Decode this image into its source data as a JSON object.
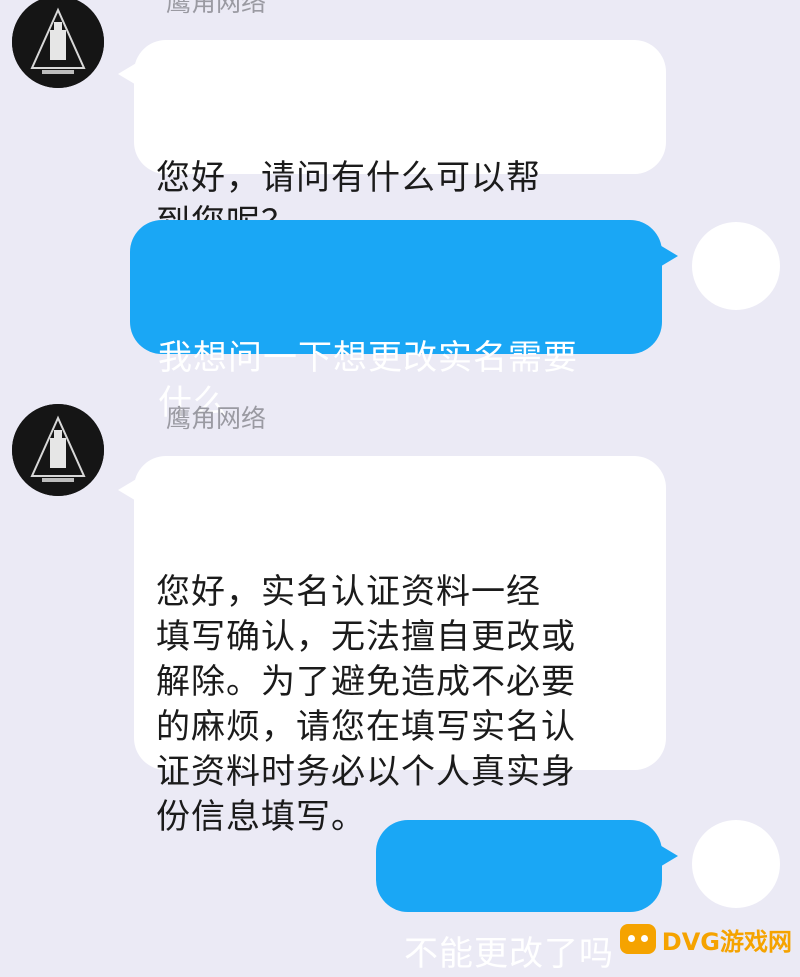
{
  "messages": [
    {
      "sender": "鹰角网络",
      "direction": "incoming",
      "text": " 您好，请问有什么可以帮\n到您呢？"
    },
    {
      "direction": "outgoing",
      "text": "我想问一下想更改实名需要\n什么"
    },
    {
      "sender": "鹰角网络",
      "direction": "incoming",
      "text": " 您好，实名认证资料一经\n填写确认，无法擅自更改或\n解除。为了避免造成不必要\n的麻烦，请您在填写实名认\n证资料时务必以个人真实身\n份信息填写。"
    },
    {
      "direction": "outgoing",
      "text": "不能更改了吗"
    }
  ],
  "watermark": {
    "text": "DVG游戏网",
    "icon": "gamepad-icon"
  },
  "colors": {
    "background": "#ebeaf5",
    "incoming_bubble": "#ffffff",
    "outgoing_bubble": "#1aa7f5",
    "sender_name": "#9a9aa2"
  }
}
